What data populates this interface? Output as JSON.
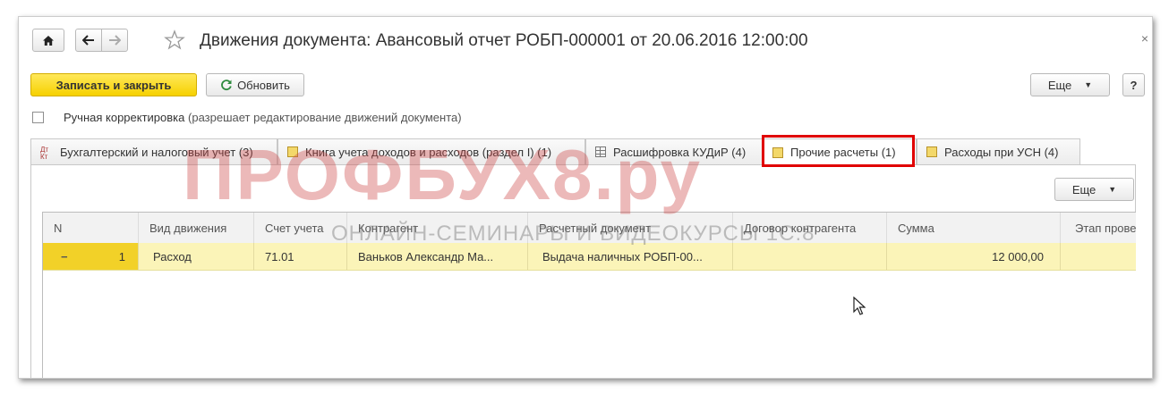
{
  "window": {
    "title": "Движения документа: Авансовый отчет РОБП-000001 от 20.06.2016 12:00:00",
    "close_glyph": "×"
  },
  "nav": {
    "home_icon": "home-icon",
    "back_icon": "arrow-left-icon",
    "forward_icon": "arrow-right-icon",
    "favorite_icon": "star-icon"
  },
  "toolbar": {
    "save_close_label": "Записать и закрыть",
    "refresh_label": "Обновить",
    "more_label": "Еще",
    "help_label": "?"
  },
  "manual_correction": {
    "label": "Ручная корректировка",
    "hint": "(разрешает редактирование движений документа)",
    "checked": false
  },
  "tabs": [
    {
      "label": "Бухгалтерский и налоговый учет (3)",
      "icon": "dt-kt-icon",
      "active": false
    },
    {
      "label": "Книга учета доходов и расходов (раздел I) (1)",
      "icon": "register-icon",
      "active": false
    },
    {
      "label": "Расшифровка КУДиР (4)",
      "icon": "table-icon",
      "active": false
    },
    {
      "label": "Прочие расчеты (1)",
      "icon": "register-icon",
      "active": true
    },
    {
      "label": "Расходы при УСН (4)",
      "icon": "register-icon",
      "active": false
    }
  ],
  "panel": {
    "more_label": "Еще"
  },
  "grid": {
    "columns": [
      "N",
      "Вид движения",
      "Счет учета",
      "Контрагент",
      "Расчетный документ",
      "Договор контрагента",
      "Сумма",
      "Этап прове"
    ],
    "rows": [
      {
        "sign": "−",
        "n": "1",
        "kind": "Расход",
        "account": "71.01",
        "counterparty": "Ваньков Александр Ма...",
        "doc": "Выдача наличных РОБП-00...",
        "contract": "",
        "sum": "12 000,00",
        "stage": ""
      }
    ]
  },
  "watermark": {
    "main": "ПРОФБУХ8.ру",
    "sub": "ОНЛАЙН-СЕМИНАРЫ И ВИДЕОКУРСЫ 1С:8"
  },
  "colors": {
    "primary_button": "#f6d100",
    "selected_row": "#fbf4b8",
    "highlight_box": "#e00000",
    "watermark": "#cd4646"
  }
}
